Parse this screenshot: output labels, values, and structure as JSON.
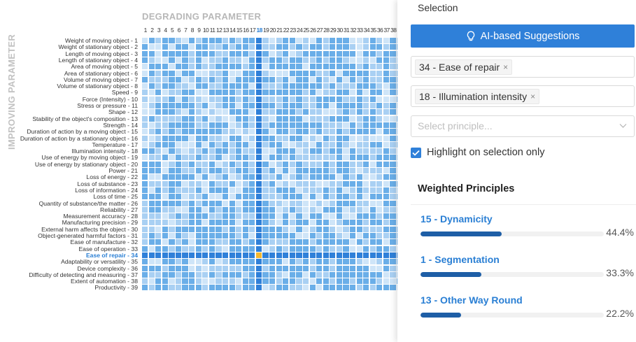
{
  "matrix": {
    "degrading_title": "DEGRADING PARAMETER",
    "improving_title": "IMPROVING PARAMETER",
    "col_count": 39,
    "selected_col": 18,
    "selected_row": 34,
    "parameters": [
      "Weight of moving object - 1",
      "Weight of stationary object - 2",
      "Length of moving object - 3",
      "Length of stationary object - 4",
      "Area of moving object - 5",
      "Area of stationary object - 6",
      "Volume of moving object - 7",
      "Volume of stationary object - 8",
      "Speed - 9",
      "Force (Intensity) - 10",
      "Stress or pressure - 11",
      "Shape - 12",
      "Stability of the object's composition - 13",
      "Strength - 14",
      "Duration of action by a moving object - 15",
      "Duration of action by a stationary object - 16",
      "Temperature - 17",
      "Illumination intensity - 18",
      "Use of energy by moving object - 19",
      "Use of energy by stationary object - 20",
      "Power - 21",
      "Loss of energy - 22",
      "Loss of substance - 23",
      "Loss of information - 24",
      "Loss of time - 25",
      "Quantity of substance/the matter - 26",
      "Reliability - 27",
      "Measurement accuracy - 28",
      "Manufacturing precision - 29",
      "External harm affects the object - 30",
      "Object-generated harmful factors - 31",
      "Ease of manufacture - 32",
      "Ease of operation - 33",
      "Ease of repair - 34",
      "Adaptability or versatility - 35",
      "Device complexity - 36",
      "Difficulty of detecting and measuring - 37",
      "Extent of automation - 38",
      "Productivity - 39"
    ],
    "colors": {
      "default": "#6aaee8",
      "light": "#a9d0f3",
      "pale": "#cfe5f8",
      "selected_line": "#2f80d9",
      "intersection": "#f5b82e"
    }
  },
  "panel": {
    "heading": "Selection",
    "ai_button_label": "AI-based Suggestions",
    "ai_icon": "lightbulb-icon",
    "selected_parameters": [
      {
        "label": "34 - Ease of repair"
      },
      {
        "label": "18 - Illumination intensity"
      }
    ],
    "chip_close_symbol": "×",
    "principle_placeholder": "Select principle...",
    "highlight_label": "Highlight on selection only",
    "highlight_checked": true,
    "weighted_title": "Weighted Principles",
    "principles": [
      {
        "name": "15 - Dynamicity",
        "percent": "44.4%",
        "value": 0.444
      },
      {
        "name": "1 - Segmentation",
        "percent": "33.3%",
        "value": 0.333
      },
      {
        "name": "13 - Other Way Round",
        "percent": "22.2%",
        "value": 0.222
      }
    ]
  }
}
